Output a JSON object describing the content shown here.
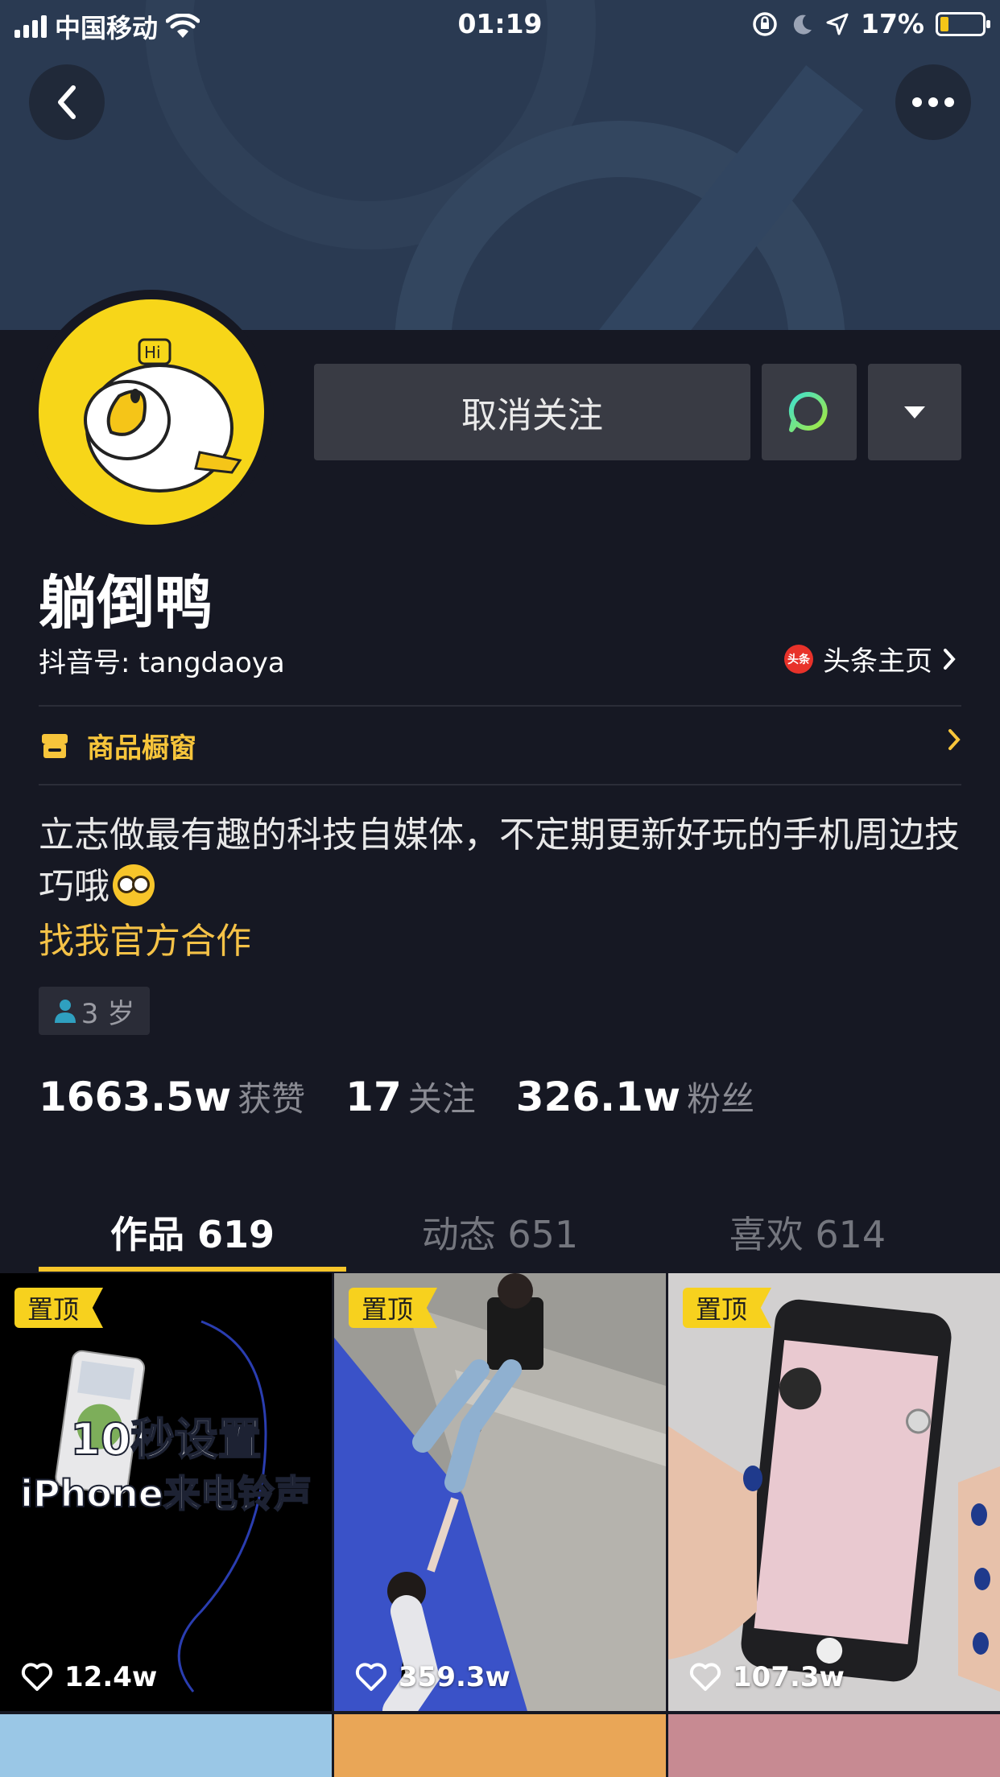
{
  "status_bar": {
    "carrier": "中国移动",
    "time": "01:19",
    "battery": "17%"
  },
  "profile": {
    "name": "躺倒鸭",
    "douyin_id": "抖音号: tangdaoya",
    "toutiao_badge": "头条",
    "toutiao_link": "头条主页",
    "shop_label": "商品橱窗",
    "bio": "立志做最有趣的科技自媒体，不定期更新好玩的手机周边技巧哦",
    "bio_link": "找我官方合作",
    "age_tag": "3 岁",
    "avatar_badge": "Hi"
  },
  "actions": {
    "unfollow_label": "取消关注"
  },
  "stats": {
    "likes_value": "1663.5w",
    "likes_label": "获赞",
    "following_value": "17",
    "following_label": "关注",
    "followers_value": "326.1w",
    "followers_label": "粉丝"
  },
  "tabs": [
    {
      "label": "作品 619",
      "active": true
    },
    {
      "label": "动态 651",
      "active": false
    },
    {
      "label": "喜欢 614",
      "active": false
    }
  ],
  "videos": [
    {
      "pin": "置顶",
      "likes": "12.4w",
      "caption_line1": "10秒设置",
      "caption_line2": "iPhone来电铃声"
    },
    {
      "pin": "置顶",
      "likes": "359.3w"
    },
    {
      "pin": "置顶",
      "likes": "107.3w"
    }
  ],
  "colors": {
    "accent": "#f7c52a",
    "background": "#161823",
    "link": "#f5c247"
  }
}
